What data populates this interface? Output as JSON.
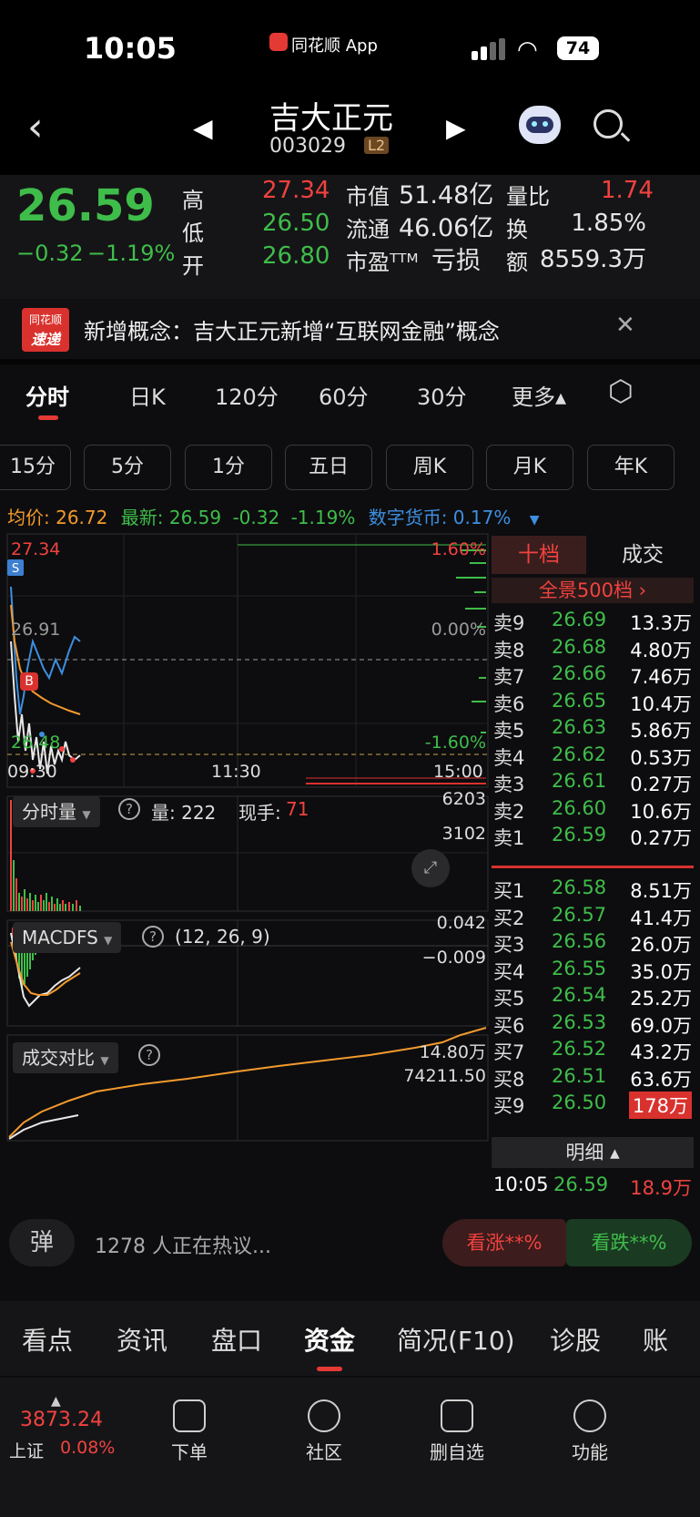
{
  "status": {
    "time": "10:05",
    "app_label": "同花顺 App",
    "battery": "74"
  },
  "header": {
    "stock_name": "吉大正元",
    "stock_code": "003029",
    "level_badge": "L2"
  },
  "quote": {
    "price": "26.59",
    "change": "−0.32",
    "change_pct": "−1.19%",
    "high_label": "高",
    "high": "27.34",
    "low_label": "低",
    "low": "26.50",
    "open_label": "开",
    "open": "26.80",
    "mcap_label": "市值",
    "mcap": "51.48亿",
    "float_label": "流通",
    "float": "46.06亿",
    "pe_label": "市盈ᵀᵀᴹ",
    "pe": "亏损",
    "vr_label": "量比",
    "vr": "1.74",
    "turnover_label": "换",
    "turnover": "1.85%",
    "amount_label": "额",
    "amount": "8559.3万"
  },
  "news": {
    "badge_top": "同花顺",
    "badge_bottom": "速递",
    "text": "新增概念：吉大正元新增“互联网金融”概念"
  },
  "tabs": [
    "分时",
    "日K",
    "120分",
    "60分",
    "30分",
    "更多▴"
  ],
  "subtabs": [
    "15分",
    "5分",
    "1分",
    "五日",
    "周K",
    "月K",
    "年K"
  ],
  "infoline": {
    "avg_label": "均价: ",
    "avg": "26.72",
    "latest_label": "最新: ",
    "latest": "26.59",
    "change": "-0.32",
    "change_pct": "-1.19%",
    "crypto": "数字货币: 0.17%"
  },
  "chart": {
    "top_price": "27.34",
    "bottom_price": "26.48",
    "mid_price": "26.91",
    "top_pct": "1.60%",
    "mid_pct": "0.00%",
    "bottom_pct": "-1.60%",
    "time_start": "09:30",
    "time_mid": "11:30",
    "time_end": "15:00",
    "vol_indicator": "分时量",
    "vol_label": "量: 222",
    "now_label": "现手: ",
    "now_value": "71",
    "vol_max": "6203",
    "vol_mid": "3102",
    "macd_indicator": "MACDFS",
    "macd_params": "(12, 26, 9)",
    "macd_top": "0.042",
    "macd_bottom": "−0.009",
    "cmp_indicator": "成交对比",
    "cmp_top": "14.80万",
    "cmp_mid": "74211.50",
    "marker_s": "S",
    "marker_b": "B"
  },
  "orderbook": {
    "tab_active": "十档",
    "tab_other": "成交",
    "panorama": "全景500档 ›",
    "asks": [
      [
        "卖9",
        "26.69",
        "13.3万"
      ],
      [
        "卖8",
        "26.68",
        "4.80万"
      ],
      [
        "卖7",
        "26.66",
        "7.46万"
      ],
      [
        "卖6",
        "26.65",
        "10.4万"
      ],
      [
        "卖5",
        "26.63",
        "5.86万"
      ],
      [
        "卖4",
        "26.62",
        "0.53万"
      ],
      [
        "卖3",
        "26.61",
        "0.27万"
      ],
      [
        "卖2",
        "26.60",
        "10.6万"
      ],
      [
        "卖1",
        "26.59",
        "0.27万"
      ]
    ],
    "bids": [
      [
        "买1",
        "26.58",
        "8.51万"
      ],
      [
        "买2",
        "26.57",
        "41.4万"
      ],
      [
        "买3",
        "26.56",
        "26.0万"
      ],
      [
        "买4",
        "26.55",
        "35.0万"
      ],
      [
        "买5",
        "26.54",
        "25.2万"
      ],
      [
        "买6",
        "26.53",
        "69.0万"
      ],
      [
        "买7",
        "26.52",
        "43.2万"
      ],
      [
        "买8",
        "26.51",
        "63.6万"
      ],
      [
        "买9",
        "26.50",
        "178万"
      ]
    ],
    "detail_label": "明细 ▴",
    "tick_time": "10:05",
    "tick_price": "26.59",
    "tick_vol": "18.9万"
  },
  "discuss": {
    "bullet_icon": "弹",
    "text": "1278 人正在热议...",
    "bull": "看涨**%",
    "bear": "看跌**%"
  },
  "bottom_tabs": [
    "看点",
    "资讯",
    "盘口",
    "资金",
    "简况(F10)",
    "诊股",
    "账"
  ],
  "dock": {
    "index_value": "3873.24",
    "index_name": "上证",
    "index_pct": "0.08%",
    "items": [
      "下单",
      "社区",
      "删自选",
      "功能"
    ]
  }
}
